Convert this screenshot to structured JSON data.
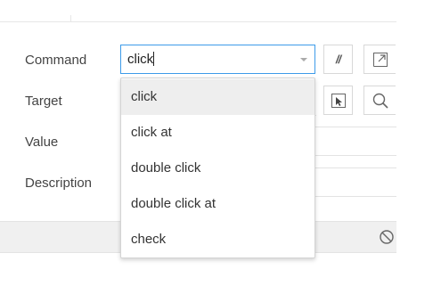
{
  "fields": {
    "command_label": "Command",
    "target_label": "Target",
    "value_label": "Value",
    "description_label": "Description"
  },
  "command_input": {
    "value": "click"
  },
  "buttons": {
    "comment_glyph": "//"
  },
  "dropdown": {
    "options": [
      "click",
      "click at",
      "double click",
      "double click at",
      "check"
    ],
    "selected_index": 0
  },
  "icons": {
    "comment": "comment-toggle-icon",
    "open_reference": "open-in-window-icon",
    "select_target": "select-target-icon",
    "find_target": "search-icon",
    "disable": "disable-icon"
  },
  "colors": {
    "focus_border": "#3d9be9",
    "selected_option_bg": "#eeeeee"
  }
}
